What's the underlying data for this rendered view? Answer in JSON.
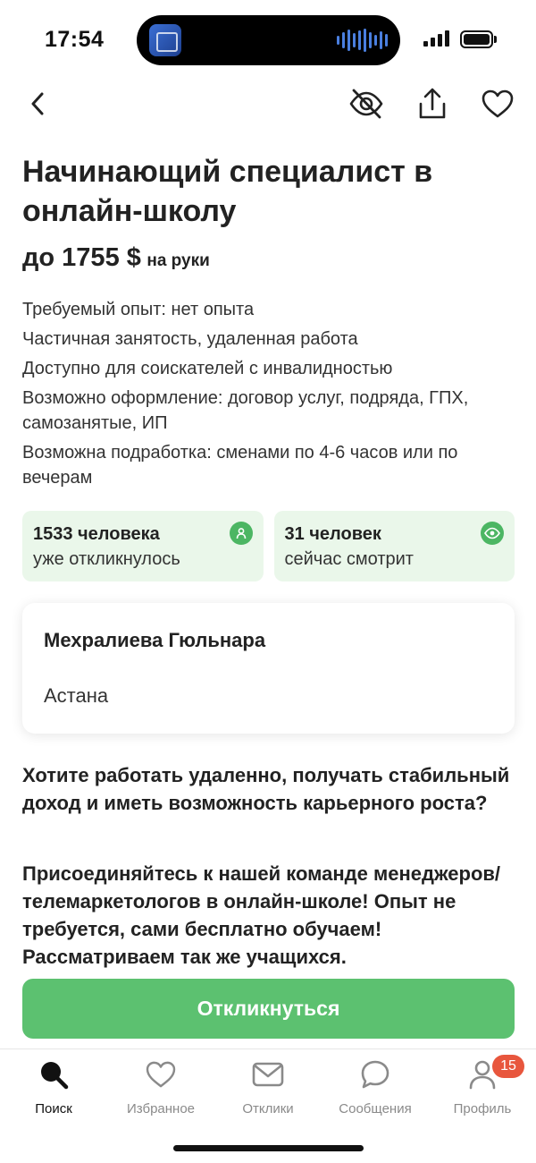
{
  "status_bar": {
    "time": "17:54",
    "battery_level": 1.0
  },
  "nav": {
    "back_icon": "chevron-left-icon",
    "hide_icon": "eye-off-icon",
    "share_icon": "share-icon",
    "favorite_icon": "heart-icon"
  },
  "vacancy": {
    "title": "Начинающий специалист в онлайн-школу",
    "salary_amount": "до 1755 $",
    "salary_suffix": "на руки",
    "features": [
      "Требуемый опыт: нет опыта",
      "Частичная занятость, удаленная работа",
      "Доступно для соискателей с инвалидностью",
      "Возможно оформление: договор услуг, подряда, ГПХ, самозанятые, ИП",
      "Возможна подработка: сменами по 4-6 часов или по вечерам"
    ]
  },
  "stats": {
    "responded_count": "1533 человека",
    "responded_label": "уже откликнулось",
    "viewing_count": "31 человек",
    "viewing_label": "сейчас смотрит",
    "accent_color": "#4cb663",
    "card_color": "#eaf7ea"
  },
  "employer": {
    "name": "Мехралиева Гюльнара",
    "city": "Астана"
  },
  "description": {
    "paragraph_1": "Хотите работать удаленно, получать стабильный доход и иметь возможность карьерного роста?",
    "paragraph_2": "Присоединяйтесь к нашей команде менеджеров/телемаркетологов в онлайн-школе! Опыт не требуется, сами бесплатно обучаем! Рассматриваем так же учащихся."
  },
  "apply_button": {
    "label": "Откликнуться",
    "color": "#5cc170"
  },
  "tab_bar": {
    "items": [
      {
        "label": "Поиск",
        "icon": "search-icon",
        "active": true
      },
      {
        "label": "Избранное",
        "icon": "heart-icon",
        "active": false
      },
      {
        "label": "Отклики",
        "icon": "mail-icon",
        "active": false
      },
      {
        "label": "Сообщения",
        "icon": "chat-bubble-icon",
        "active": false
      },
      {
        "label": "Профиль",
        "icon": "profile-icon",
        "active": false
      }
    ],
    "profile_badge": "15",
    "badge_color": "#e8563d"
  }
}
